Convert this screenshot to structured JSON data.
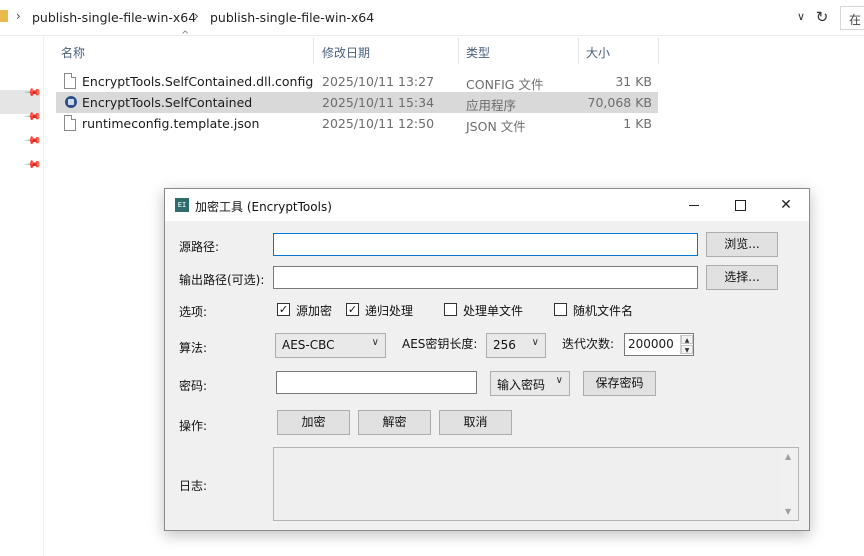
{
  "explorer": {
    "breadcrumb": [
      "publish-single-file-win-x64",
      "publish-single-file-win-x64"
    ],
    "search_placeholder": "在",
    "columns": {
      "name": "名称",
      "date": "修改日期",
      "type": "类型",
      "size": "大小"
    },
    "files": [
      {
        "name": "EncryptTools.SelfContained.dll.config",
        "date": "2025/10/11 13:27",
        "type": "CONFIG 文件",
        "size": "31 KB",
        "icon": "file-icon",
        "selected": false
      },
      {
        "name": "EncryptTools.SelfContained",
        "date": "2025/10/11 15:34",
        "type": "应用程序",
        "size": "70,068 KB",
        "icon": "app-icon",
        "selected": true
      },
      {
        "name": "runtimeconfig.template.json",
        "date": "2025/10/11 12:50",
        "type": "JSON 文件",
        "size": "1 KB",
        "icon": "file-icon",
        "selected": false
      }
    ]
  },
  "dialog": {
    "app_icon_text": "EI",
    "title": "加密工具 (EncryptTools)",
    "source_label": "源路径:",
    "source_value": "",
    "browse_button": "浏览...",
    "output_label": "输出路径(可选):",
    "output_value": "",
    "select_button": "选择...",
    "options_label": "选项:",
    "options": [
      {
        "label": "源加密",
        "checked": true
      },
      {
        "label": "递归处理",
        "checked": true
      },
      {
        "label": "处理单文件",
        "checked": false
      },
      {
        "label": "随机文件名",
        "checked": false
      }
    ],
    "algorithm_label": "算法:",
    "algorithm_value": "AES-CBC",
    "key_length_label": "AES密钥长度:",
    "key_length_value": "256",
    "iterations_label": "迭代次数:",
    "iterations_value": "200000",
    "password_label": "密码:",
    "password_value": "",
    "password_mode": "输入密码",
    "save_password_button": "保存密码",
    "actions_label": "操作:",
    "encrypt_button": "加密",
    "decrypt_button": "解密",
    "cancel_button": "取消",
    "log_label": "日志:",
    "log_text": ""
  }
}
